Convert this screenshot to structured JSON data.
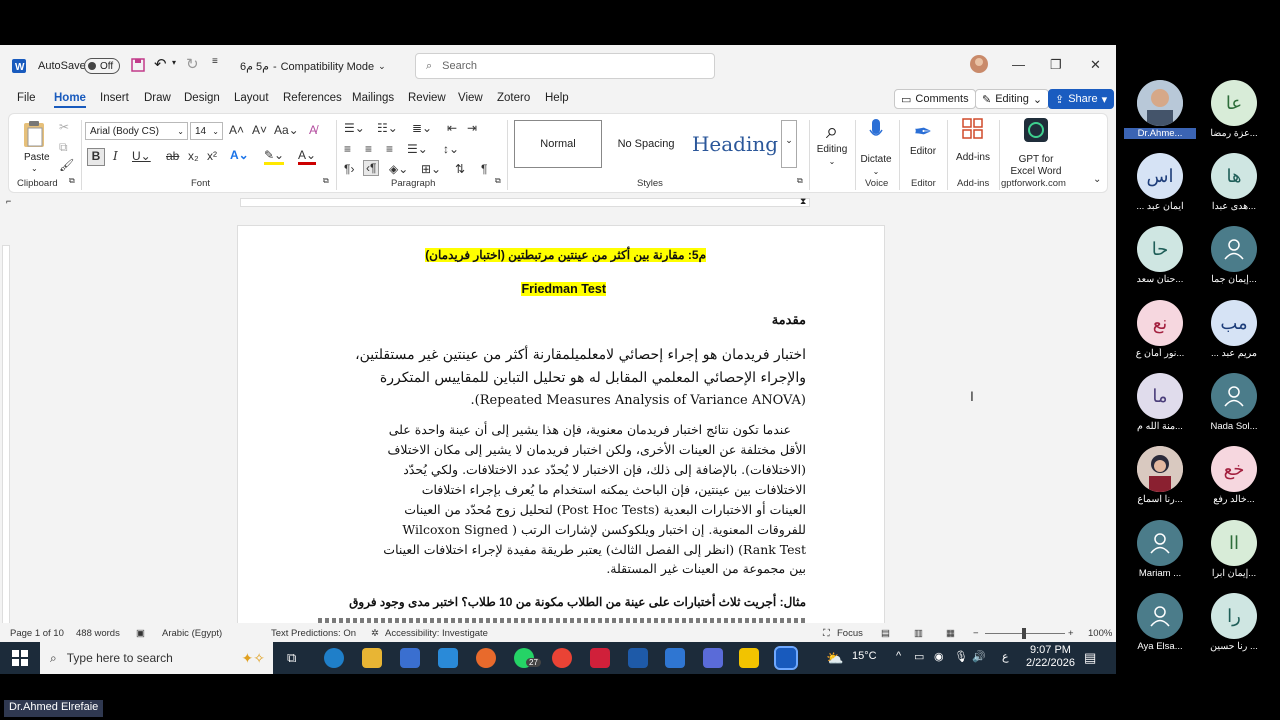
{
  "titlebar": {
    "autosave_label": "AutoSave",
    "autosave_state": "Off",
    "doc_title": "م5 م6",
    "mode": "Compatibility Mode",
    "search_placeholder": "Search"
  },
  "menu": {
    "items": [
      "File",
      "Home",
      "Insert",
      "Draw",
      "Design",
      "Layout",
      "References",
      "Mailings",
      "Review",
      "View",
      "Zotero",
      "Help"
    ],
    "active": "Home"
  },
  "header_buttons": {
    "comments": "Comments",
    "editing": "Editing",
    "share": "Share"
  },
  "ribbon": {
    "clipboard": {
      "paste": "Paste",
      "label": "Clipboard"
    },
    "font": {
      "name": "Arial (Body CS)",
      "size": "14",
      "label": "Font"
    },
    "paragraph": {
      "label": "Paragraph"
    },
    "styles": {
      "normal": "Normal",
      "no_spacing": "No Spacing",
      "heading": "Heading",
      "label": "Styles"
    },
    "editing": {
      "label": "Editing"
    },
    "voice": {
      "dictate": "Dictate",
      "label": "Voice"
    },
    "editor": {
      "editor": "Editor",
      "label": "Editor"
    },
    "addins": {
      "addins": "Add-ins",
      "label": "Add-ins"
    },
    "gpt": {
      "line1": "GPT for",
      "line2": "Excel Word",
      "label": "gptforwork.com"
    }
  },
  "document": {
    "title": "م5: مقارنة بين أكثر من عينتين مرتبطتين (اختبار فريدمان)",
    "subtitle": "Friedman Test",
    "heading": "مقدمة",
    "para1": [
      "اختبار فريدمان هو إجراء إحصائي لامعلميلمقارنة أكثر من عينتين غير مستقلتين،",
      "والإجراء الإحصائي المعلمي المقابل له هو تحليل التباين للمقاييس المتكررة",
      "(Repeated Measures Analysis of Variance ANOVA)."
    ],
    "para2": [
      "عندما تكون نتائج اختبار فريدمان معنوية، فإن هذا يشير إلى أن عينة واحدة على",
      "الأقل مختلفة عن العينات الأخرى، ولكن اختبار فريدمان لا يشير إلى مكان الاختلاف",
      "(الاختلافات). بالإضافة إلى ذلك، فإن الاختبار لا يُحدّد عدد الاختلافات. ولكي يُحدّد",
      "الاختلافات بين عينتين، فإن الباحث يمكنه استخدام ما يُعرف بإجراء اختلافات",
      "العينات أو الاختبارات البعدية (Post Hoc Tests) لتحليل زوج مُحدّد من العينات",
      "للفروقات المعنوية. إن اختبار ويلكوكسن لإشارات الرتب ( Wilcoxon Signed",
      "Rank Test) (انظر إلى الفصل الثالث) يعتبر طريقة مفيدة لإجراء اختلافات العينات",
      "بين مجموعة من العينات غير المستقلة."
    ],
    "example": "مثال: أجريت ثلاث أختبارات على عينة من الطلاب مكونة من 10 طلاب؟ اختبر مدى وجود فروق"
  },
  "status": {
    "page": "Page 1 of 10",
    "words": "488 words",
    "language": "Arabic (Egypt)",
    "predictions": "Text Predictions: On",
    "accessibility": "Accessibility: Investigate",
    "focus": "Focus",
    "zoom": "100%"
  },
  "taskbar": {
    "search_placeholder": "Type here to search",
    "badge": "27",
    "weather": "15°C",
    "lang": "ع",
    "time": "9:07 PM",
    "date": "2/22/2026"
  },
  "participants": [
    {
      "initials": "",
      "name": "Dr.Ahme...",
      "color": "#7a8a9a",
      "photo": true
    },
    {
      "initials": "عا",
      "name": "عزة رمضا...",
      "color": "#d8ecd8"
    },
    {
      "initials": "اس",
      "name": "... ايمان عبد",
      "color": "#d6e3f5"
    },
    {
      "initials": "ها",
      "name": "هدى عبدا...",
      "color": "#cfe6e2"
    },
    {
      "initials": "حا",
      "name": "حنان سعد...",
      "color": "#cfe6e2"
    },
    {
      "initials": "",
      "name": "إيمان جما...",
      "color": "#4b7c8a",
      "default": true
    },
    {
      "initials": "نع",
      "name": "نور أمان ع...",
      "color": "#f6d7df"
    },
    {
      "initials": "مب",
      "name": "... مريم عبد",
      "color": "#d6e3f5"
    },
    {
      "initials": "ما",
      "name": "منة الله م...",
      "color": "#e0dcec"
    },
    {
      "initials": "",
      "name": "Nada Sol...",
      "color": "#4b7c8a",
      "default": true
    },
    {
      "initials": "",
      "name": "رنا اسماع...",
      "color": "#c9a7a0",
      "photo": true
    },
    {
      "initials": "خع",
      "name": "خالد رفع...",
      "color": "#f6d7df"
    },
    {
      "initials": "",
      "name": "Mariam ...",
      "color": "#4b7c8a",
      "default": true
    },
    {
      "initials": "اا",
      "name": "إيمان ابرا...",
      "color": "#d8ecd8"
    },
    {
      "initials": "",
      "name": "Aya Elsa...",
      "color": "#4b7c8a",
      "default": true
    },
    {
      "initials": "را",
      "name": "رنا حسين ...",
      "color": "#cfe6e2"
    }
  ],
  "presenter": "Dr.Ahmed Elrefaie",
  "colors": {
    "accent": "#185abd",
    "highlight": "#ffff00"
  }
}
